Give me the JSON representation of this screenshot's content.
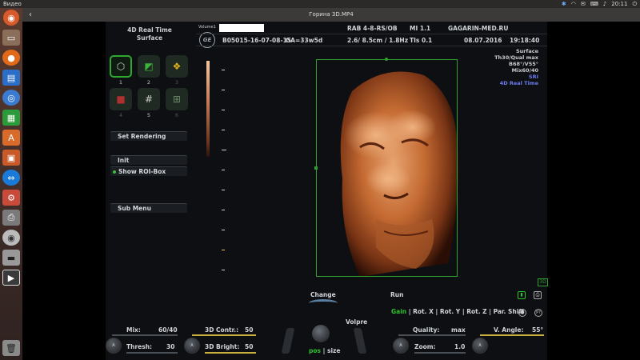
{
  "system_bar": {
    "app_name": "Видео",
    "time": "20:11",
    "tray_icons": [
      "bluetooth-icon",
      "wifi-icon",
      "mail-icon",
      "keyboard-icon",
      "volume-icon",
      "power-icon"
    ]
  },
  "window": {
    "title": "Горина 3D.MP4",
    "back_glyph": "‹"
  },
  "launcher": {
    "items": [
      "dash-icon",
      "files-icon",
      "firefox-icon",
      "writer-icon",
      "network-icon",
      "calc-icon",
      "software-icon",
      "impress-icon",
      "teamviewer-icon",
      "settings-icon",
      "printer-icon",
      "disc-icon",
      "drive-icon",
      "video-icon",
      "trash-icon"
    ]
  },
  "ultrasound": {
    "mode_title_line1": "4D Real Time",
    "mode_title_line2": "Surface",
    "volume_label": "Volume1",
    "probe": "RAB 4-8-RS/OB",
    "mi": "MI  1.1",
    "clinic": "GAGARIN-MED.RU",
    "patient_id": "B05015-16-07-08-15",
    "ga": "GA=33w5d",
    "depth": "2.6/ 8.5cm / 1.8Hz",
    "tis": "TIs  0.1",
    "date": "08.07.2016",
    "time": "19:18:40",
    "logo": "GE",
    "tools": [
      {
        "num": "1",
        "icon": "cube-icon"
      },
      {
        "num": "2",
        "icon": "render-plane-icon"
      },
      {
        "num": "3",
        "icon": "color-blobs-icon"
      },
      {
        "num": "4",
        "icon": "red-cube-icon"
      },
      {
        "num": "5",
        "icon": "grid-icon"
      },
      {
        "num": "6",
        "icon": "grid-cursor-icon"
      }
    ],
    "buttons": {
      "set_rendering": "Set Rendering",
      "init": "Init",
      "show_roi": "Show ROI-Box",
      "sub_menu": "Sub Menu"
    },
    "render_info": [
      "Surface",
      "Th30/Qual max",
      "B68°/V55°",
      "Mix60/40",
      "SRI",
      "4D Real Time"
    ],
    "tag_3d": "3D",
    "bottom": {
      "change": "Change",
      "run": "Run",
      "gain_row": {
        "gain": "Gain",
        "rest": "| Rot. X | Rot. Y | Rot. Z | Par. Shift"
      },
      "help": "P?",
      "mix_label": "Mix:",
      "mix_value": "60/40",
      "thresh_label": "Thresh:",
      "thresh_value": "30",
      "contr_label": "3D Contr.:",
      "contr_value": "50",
      "bright_label": "3D Bright:",
      "bright_value": "50",
      "volpre": "Volpre",
      "pos_size_pos": "pos",
      "pos_size_rest": "| size",
      "quality_label": "Quality:",
      "quality_value": "max",
      "vangle_label": "V. Angle:",
      "vangle_value": "55°",
      "zoom_label": "Zoom:",
      "zoom_value": "1.0"
    }
  }
}
